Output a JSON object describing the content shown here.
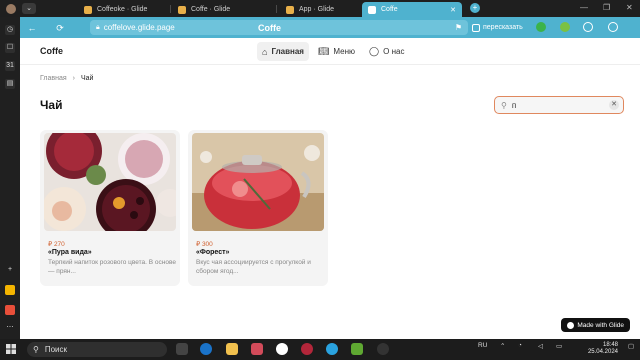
{
  "browser": {
    "tabs": [
      {
        "label": "Coffeoke · Glide",
        "color": "#e8b04a"
      },
      {
        "label": "Coffe · Glide",
        "color": "#e8b04a"
      },
      {
        "label": "App · Glide",
        "color": "#e8b04a"
      },
      {
        "label": "Coffe",
        "color": "#ffffff",
        "active": true
      }
    ],
    "url": "coffelove.glide.page",
    "page_title": "Coffe",
    "retell_label": "пересказать"
  },
  "app": {
    "brand": "Coffe",
    "menu": [
      {
        "label": "Главная",
        "icon": "home-icon",
        "active": true
      },
      {
        "label": "Меню",
        "icon": "book-icon"
      },
      {
        "label": "О нас",
        "icon": "chat-icon"
      }
    ],
    "breadcrumb": {
      "root": "Главная",
      "separator": "›",
      "current": "Чай"
    },
    "heading": "Чай",
    "search": {
      "value": "п"
    },
    "cards": [
      {
        "price": "₽ 270",
        "name": "«Пура вида»",
        "desc": "Терпкий напиток розового цвета. В основе — прян..."
      },
      {
        "price": "₽ 300",
        "name": "«Форест»",
        "desc": "Вкус чая ассоциируется с прогулкой и сбором ягод..."
      }
    ],
    "badge": "Made with Glide"
  },
  "taskbar": {
    "search_label": "Поиск",
    "lang": "RU",
    "time": "18:48",
    "date": "25.04.2024"
  }
}
